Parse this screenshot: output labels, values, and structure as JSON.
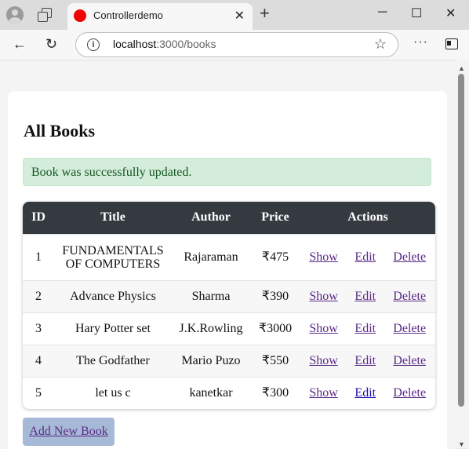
{
  "browser": {
    "tab_title": "Controllerdemo",
    "tab_close": "✕",
    "new_tab": "+",
    "url_host": "localhost",
    "url_path": ":3000/books",
    "icons": [
      "profile-icon",
      "workspaces-icon",
      "back-icon",
      "refresh-icon",
      "info-icon",
      "favorite-star-icon",
      "more-icon",
      "split-screen-icon",
      "minimize-icon",
      "maximize-icon",
      "close-icon"
    ]
  },
  "page": {
    "heading": "All Books",
    "flash": "Book was successfully updated.",
    "add_button": "Add New Book"
  },
  "table": {
    "headers": [
      "ID",
      "Title",
      "Author",
      "Price",
      "Actions"
    ],
    "rows": [
      {
        "id": "1",
        "title": "FUNDAMENTALS OF COMPUTERS",
        "author": "Rajaraman",
        "price": "₹475",
        "show": "Show",
        "edit": "Edit",
        "delete": "Delete"
      },
      {
        "id": "2",
        "title": "Advance Physics",
        "author": "Sharma",
        "price": "₹390",
        "show": "Show",
        "edit": "Edit",
        "delete": "Delete"
      },
      {
        "id": "3",
        "title": "Hary Potter set",
        "author": "J.K.Rowling",
        "price": "₹3000",
        "show": "Show",
        "edit": "Edit",
        "delete": "Delete"
      },
      {
        "id": "4",
        "title": "The Godfather",
        "author": "Mario Puzo",
        "price": "₹550",
        "show": "Show",
        "edit": "Edit",
        "delete": "Delete"
      },
      {
        "id": "5",
        "title": "let us c",
        "author": "kanetkar",
        "price": "₹300",
        "show": "Show",
        "edit": "Edit",
        "delete": "Delete"
      }
    ]
  },
  "colors": {
    "table_header_bg": "#343a40",
    "alert_bg": "#d4edda",
    "alert_text": "#155724",
    "link": "#5b2a86",
    "button_bg": "#a6b9d6"
  }
}
